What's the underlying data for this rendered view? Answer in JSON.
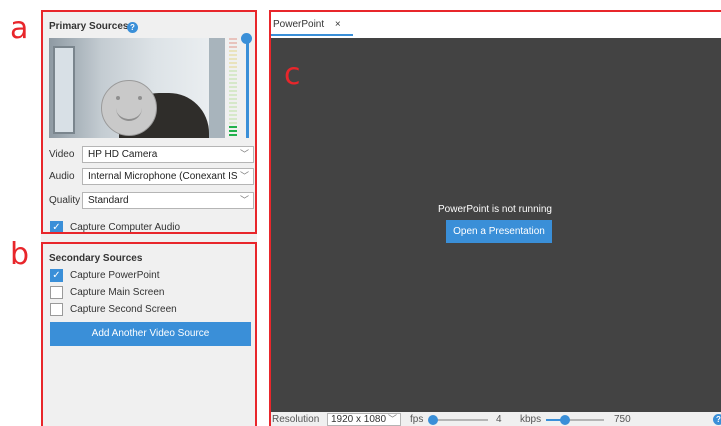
{
  "annotations": {
    "a": "a",
    "b": "b",
    "c": "c"
  },
  "primary": {
    "title": "Primary Sources",
    "help_icon": "question-icon",
    "video_label": "Video",
    "video_value": "HP HD Camera",
    "audio_label": "Audio",
    "audio_value": "Internal Microphone (Conexant IS",
    "quality_label": "Quality",
    "quality_value": "Standard",
    "capture_audio_label": "Capture Computer Audio",
    "capture_audio_checked": true,
    "mic_volume_level": 1.0,
    "audio_meter_level": 0.15
  },
  "secondary": {
    "title": "Secondary Sources",
    "options": [
      {
        "label": "Capture PowerPoint",
        "checked": true
      },
      {
        "label": "Capture Main Screen",
        "checked": false
      },
      {
        "label": "Capture Second Screen",
        "checked": false
      }
    ],
    "add_button": "Add Another Video Source"
  },
  "main": {
    "tab_label": "PowerPoint",
    "tab_close": "×",
    "message": "PowerPoint is not running",
    "open_button": "Open a Presentation"
  },
  "bottom": {
    "resolution_label": "Resolution",
    "resolution_value": "1920 x 1080",
    "fps_label": "fps",
    "fps_value": "4",
    "kbps_label": "kbps",
    "kbps_value": "750"
  },
  "colors": {
    "accent": "#3a8fd8",
    "annotation": "#e8262b",
    "preview_bg": "#434343"
  },
  "glyphs": {
    "chevron": "﹀",
    "check": "✓"
  }
}
